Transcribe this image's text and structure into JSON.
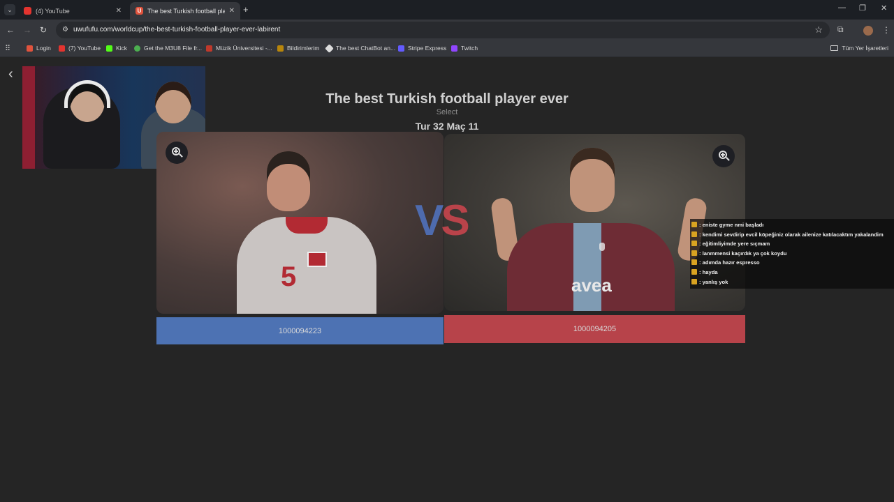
{
  "browser": {
    "tabs": [
      {
        "title": "(4) YouTube",
        "icon": "youtube-icon"
      },
      {
        "title": "The best Turkish football player",
        "icon": "uwufufu-icon",
        "active": true
      }
    ],
    "new_tab": "+",
    "url": "uwufufu.com/worldcup/the-best-turkish-football-player-ever-labirent",
    "bookmarks": [
      {
        "label": "Login",
        "icon": "e-icon",
        "color": "#e0533d"
      },
      {
        "label": "(7) YouTube",
        "icon": "youtube-icon",
        "color": "#e3342f"
      },
      {
        "label": "Kick",
        "icon": "kick-icon",
        "color": "#53fc18"
      },
      {
        "label": "Get the M3U8 File fr...",
        "icon": "m3u8-icon",
        "color": "#4caf50"
      },
      {
        "label": "Müzik Üniversitesi -...",
        "icon": "music-icon",
        "color": "#c0392b"
      },
      {
        "label": "Bildirimlerim",
        "icon": "bell-icon",
        "color": "#b8860b"
      },
      {
        "label": "The best ChatBot an...",
        "icon": "chatbot-icon",
        "color": "#dcdcdc"
      },
      {
        "label": "Stripe Express",
        "icon": "stripe-icon",
        "color": "#635bff"
      },
      {
        "label": "Twitch",
        "icon": "twitch-icon",
        "color": "#9146ff"
      }
    ],
    "all_bookmarks": "Tüm Yer İşaretleri"
  },
  "page": {
    "title": "The best Turkish football player ever",
    "subtitle": "Select",
    "round": "Tur 32 Maç 11",
    "left_choice": {
      "vote_label": "1000094223",
      "color": "#4d72b3"
    },
    "right_choice": {
      "vote_label": "1000094205",
      "color": "#b7434a"
    },
    "vs_left": "V",
    "vs_right": "S"
  },
  "chat": [
    {
      "text": ": eniste gyme nmi başladı"
    },
    {
      "text": ": kendimi sevdirip evcil köpeğiniz olarak ailenize katılacaktım yakalandim"
    },
    {
      "text": ": eğitimliyimde yere sıçmam"
    },
    {
      "text": ": lanmmensi kaçırdık ya çok koydu"
    },
    {
      "text": ": adımda hazır espresso"
    },
    {
      "text": ": hayda"
    },
    {
      "text": ": yanlış yok"
    }
  ]
}
